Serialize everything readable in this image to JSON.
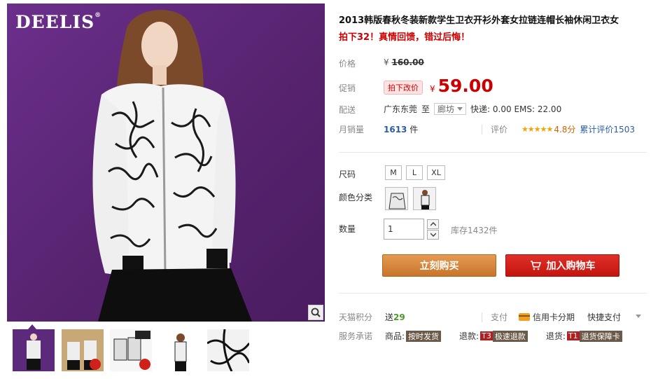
{
  "gallery": {
    "brand": "DEELIS",
    "brand_mark": "®"
  },
  "product": {
    "title": "2013韩版春秋冬装新款学生卫衣开衫外套女拉链连帽长袖休闲卫衣女",
    "promo_text": "拍下32！真情回馈，错过后悔！"
  },
  "price": {
    "label": "价格",
    "currency": "¥",
    "list_price": "160.00"
  },
  "promotion": {
    "label": "促销",
    "badge": "拍下改价",
    "currency": "¥",
    "price": "59.00"
  },
  "shipping": {
    "label": "配送",
    "origin": "广东东莞",
    "to": "至",
    "destination": "廊坊",
    "fees": "快递: 0.00 EMS: 22.00"
  },
  "sales": {
    "label": "月销量",
    "count": "1613",
    "unit": "件"
  },
  "rating": {
    "label": "评价",
    "stars": "★★★★★",
    "score": "4.8分",
    "reviews": "累计评价1503"
  },
  "options": {
    "size_label": "尺码",
    "sizes": [
      "M",
      "L",
      "XL"
    ],
    "color_label": "颜色分类"
  },
  "quantity": {
    "label": "数量",
    "value": "1",
    "stock": "库存1432件"
  },
  "actions": {
    "buy_now": "立刻购买",
    "add_to_cart": "加入购物车"
  },
  "footer": {
    "points_label": "天猫积分",
    "points_prefix": "送",
    "points_value": "29",
    "pay_label": "支付",
    "pay_credit": "信用卡分期",
    "pay_quick": "快捷支付",
    "promise_label": "服务承诺",
    "promise_goods_label": "商品:",
    "promise_goods_tag": "按时发货",
    "promise_refund_label": "退款:",
    "promise_refund_code": "T3",
    "promise_refund_tag": "极速退款",
    "promise_return_label": "退货:",
    "promise_return_code": "T1",
    "promise_return_tag": "退货保障卡"
  },
  "colors": {
    "brand_purple": "#5b2a7a",
    "price_red": "#cc0000",
    "buy_orange": "#d98a3e",
    "cart_red": "#d0201a",
    "link_blue": "#2a5da8"
  }
}
